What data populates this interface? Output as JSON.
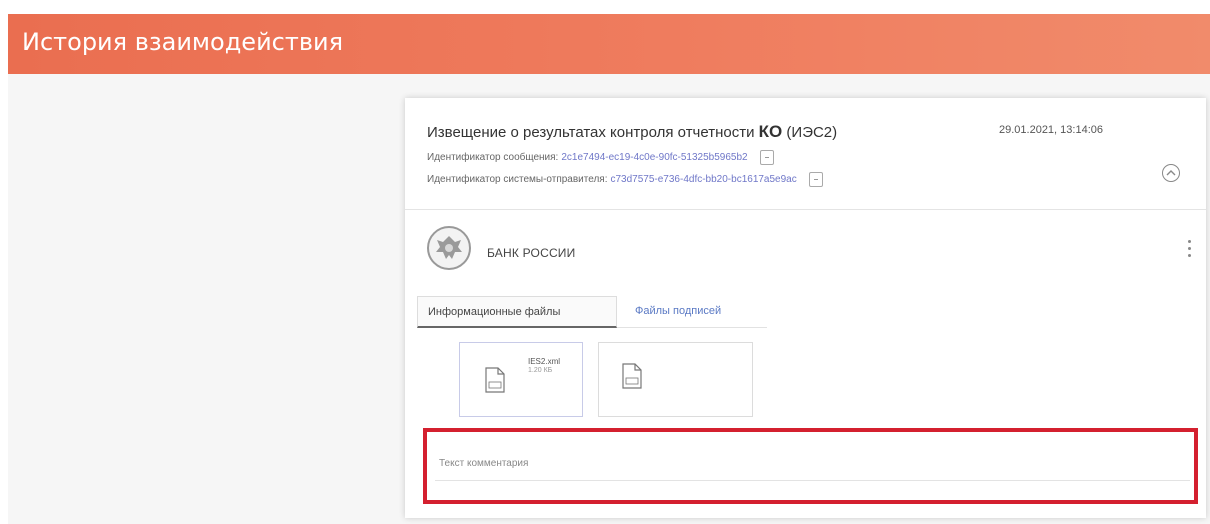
{
  "header": {
    "title": "История взаимодействия"
  },
  "message": {
    "title_prefix": "Извещение о результатах контроля отчетности",
    "title_bold": "КО",
    "title_suffix": "(ИЭС2)",
    "date": "29.01.2021, 13:14:06",
    "message_id_label": "Идентификатор сообщения:",
    "message_id": "2c1e7494-ec19-4c0e-90fc-51325b5965b2",
    "sender_system_id_label": "Идентификатор системы-отправителя:",
    "sender_system_id": "c73d7575-e736-4dfc-bb20-bc1617a5e9ac"
  },
  "sender": {
    "name": "БАНК РОССИИ"
  },
  "tabs": [
    {
      "label": "Информационные файлы",
      "active": true
    },
    {
      "label": "Файлы подписей",
      "active": false
    }
  ],
  "files": [
    {
      "name": "IES2.xml",
      "size": "1.20 КБ",
      "icon": "xml-file-icon"
    },
    {
      "name": "",
      "size": "",
      "icon": "txt-file-icon"
    }
  ],
  "comment": {
    "placeholder": "Текст комментария"
  },
  "colors": {
    "header": "#ef7658",
    "link": "#6f77c8",
    "highlight": "#d4202f"
  }
}
